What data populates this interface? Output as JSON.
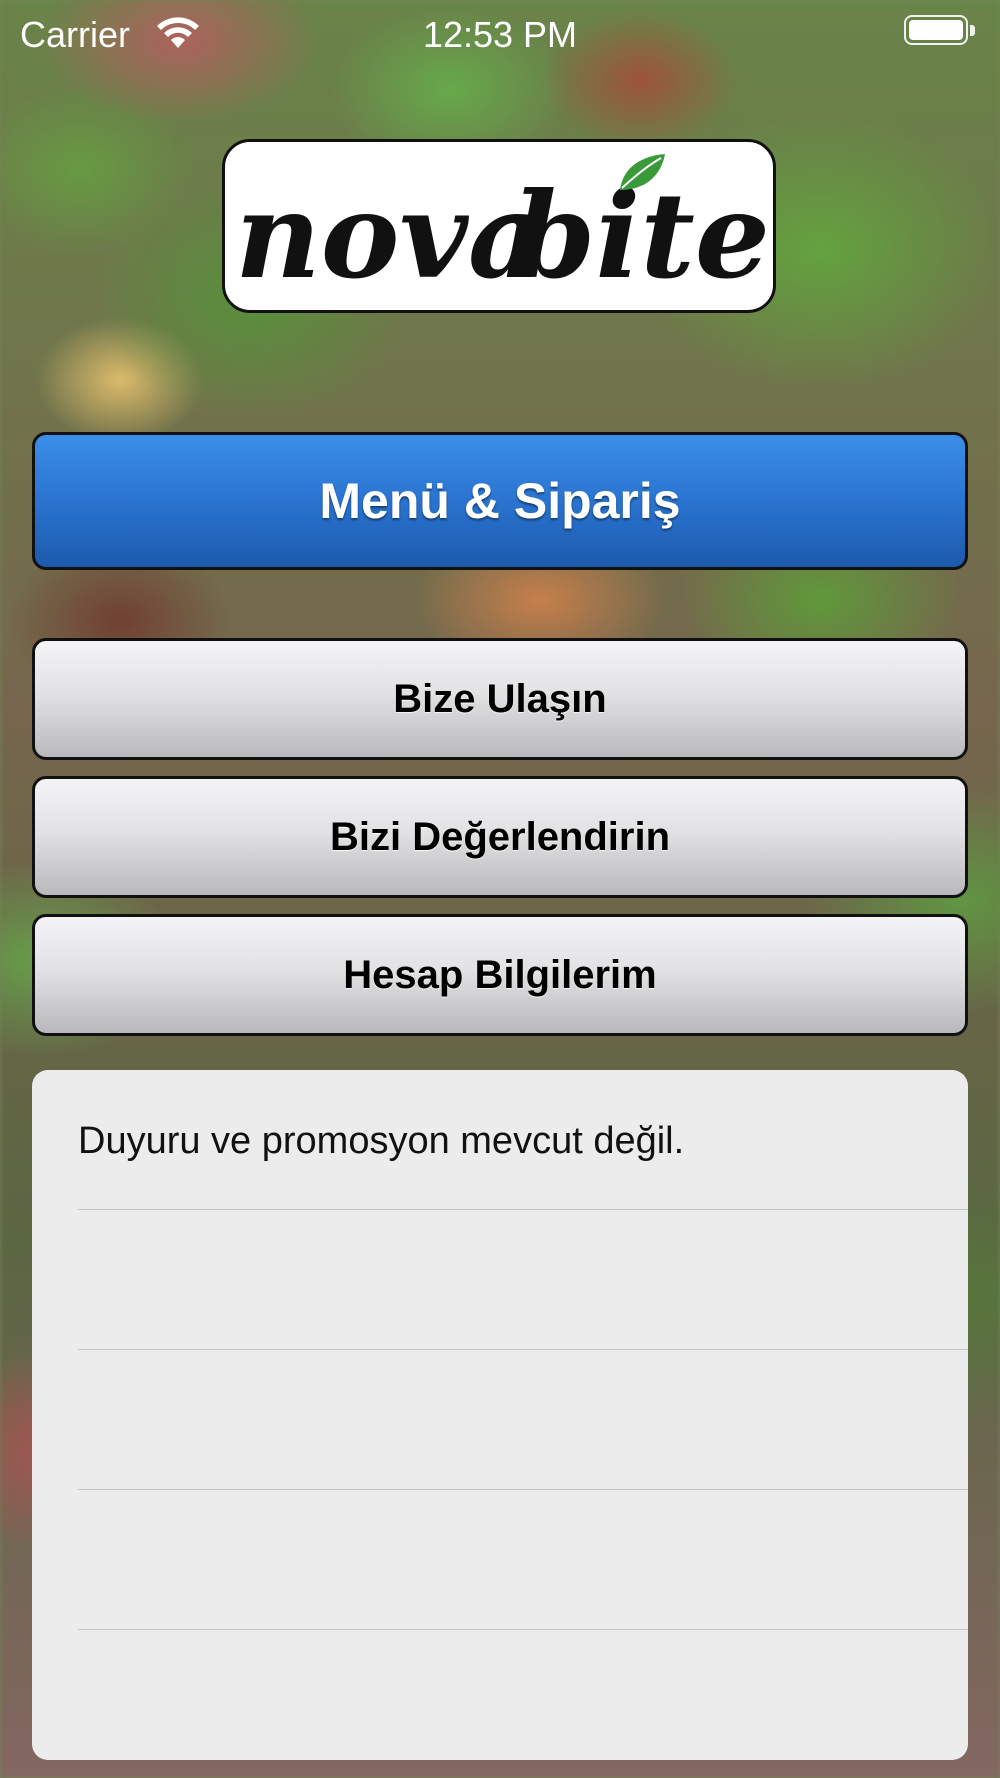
{
  "status_bar": {
    "carrier": "Carrier",
    "time": "12:53 PM"
  },
  "logo": {
    "text_left": "nova",
    "text_right": "bite",
    "leaf_color": "#3a9a3a"
  },
  "buttons": {
    "menu_order": "Menü & Sipariş",
    "contact": "Bize Ulaşın",
    "rate": "Bizi Değerlendirin",
    "account": "Hesap Bilgilerim"
  },
  "announcements": {
    "rows": [
      "Duyuru ve promosyon mevcut değil.",
      "",
      "",
      "",
      ""
    ]
  },
  "colors": {
    "primary_button": "#2a74d0",
    "panel_background": "#ececec"
  }
}
